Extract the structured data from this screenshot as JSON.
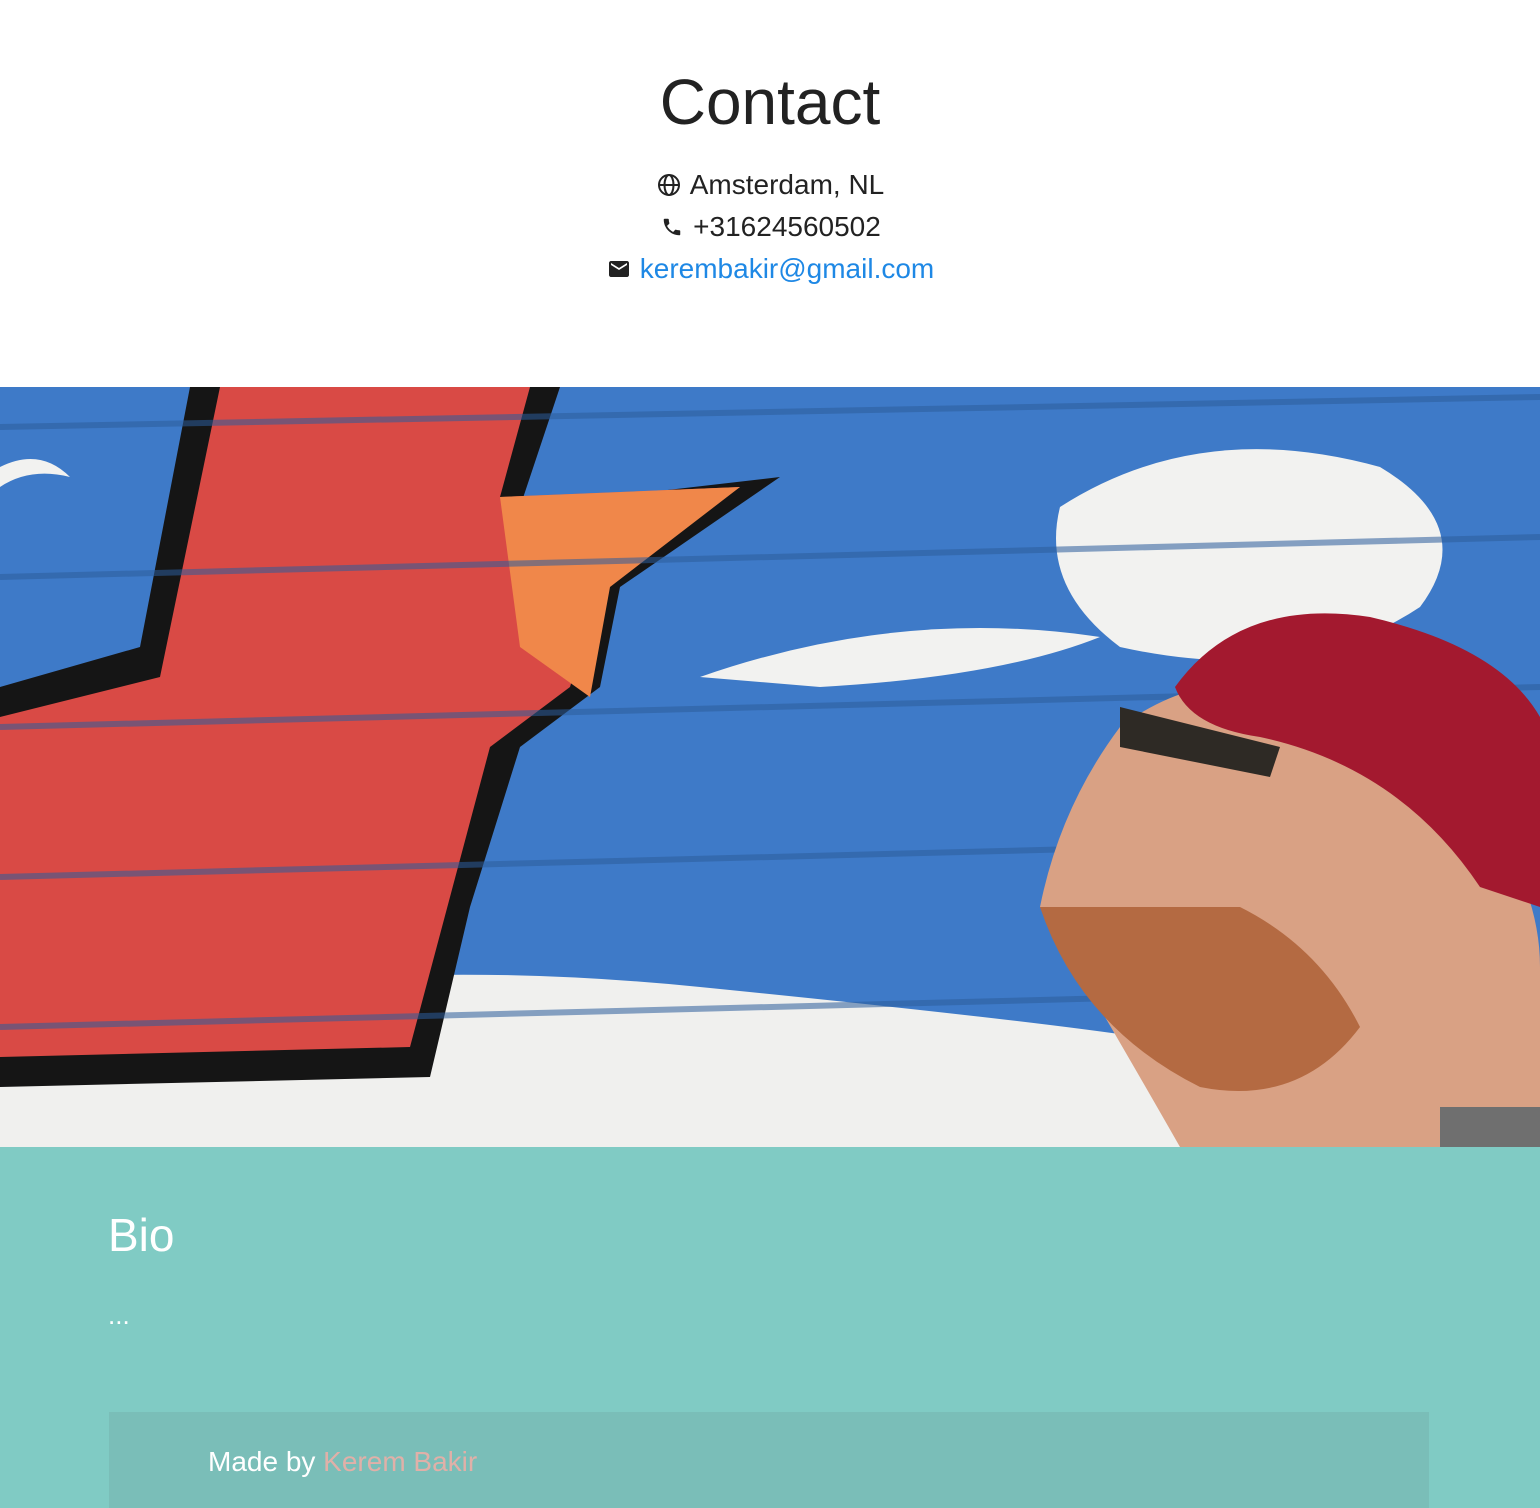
{
  "contact": {
    "title": "Contact",
    "location": "Amsterdam, NL",
    "phone": "+31624560502",
    "email": "kerembakir@gmail.com",
    "icons": [
      "globe-icon",
      "phone-icon",
      "mail-icon"
    ]
  },
  "hero": {
    "caption": "..."
  },
  "bio": {
    "title": "Bio",
    "text": "..."
  },
  "footer": {
    "prefix": "Made by ",
    "author": "Kerem Bakir"
  },
  "colors": {
    "bio_background": "#80cbc4",
    "footer_background": "#7abeb8",
    "link_blue": "#1e88e5",
    "footer_link": "#e0b0a8"
  }
}
